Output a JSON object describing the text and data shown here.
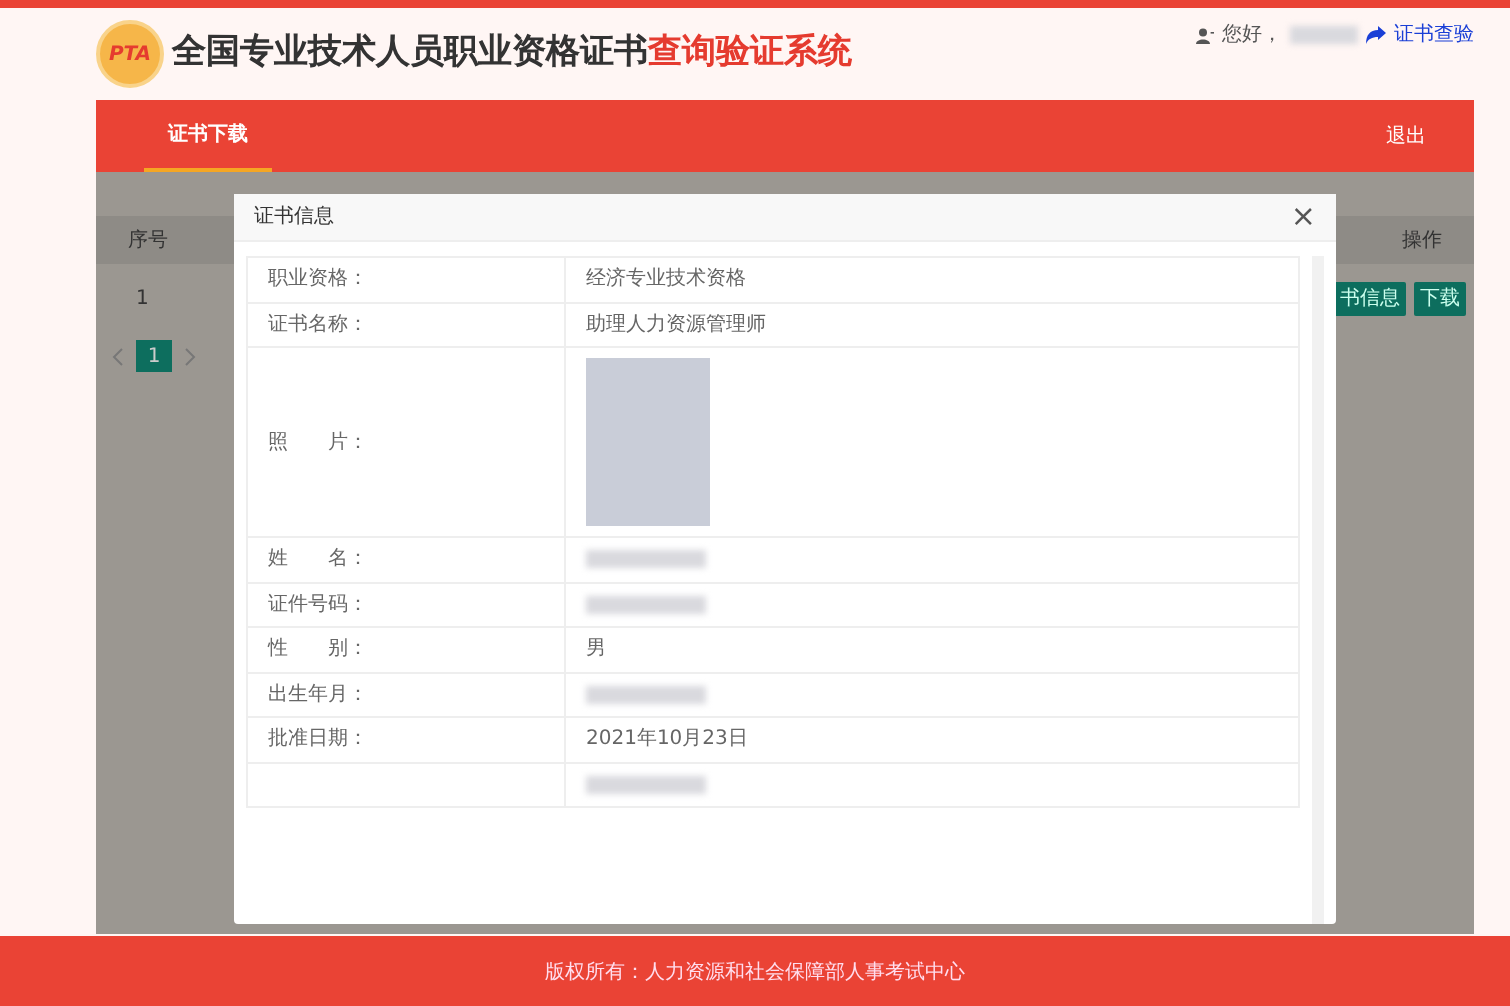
{
  "header": {
    "logo_text": "PTA",
    "title": "全国专业技术人员职业资格证书",
    "title_highlight": "查询验证系统",
    "greeting": "您好，",
    "user_link": "证书查验"
  },
  "nav": {
    "tabs": [
      {
        "label": "证书下载",
        "selected": true
      }
    ],
    "logout": "退出"
  },
  "background_table": {
    "columns": [
      "序号",
      "操作"
    ],
    "rows": [
      {
        "number": "1",
        "actions": [
          "书信息",
          "下载"
        ]
      }
    ],
    "pagination": [
      {
        "label": "1",
        "selected": true
      }
    ]
  },
  "modal": {
    "title": "证书信息",
    "close": "×",
    "rows": [
      {
        "kind": "text",
        "label": "职业资格：",
        "value": "经济专业技术资格"
      },
      {
        "kind": "text",
        "label": "证书名称：",
        "value": "助理人力资源管理师"
      },
      {
        "kind": "photo",
        "label": "照　　片："
      },
      {
        "kind": "redacted",
        "label": "姓　　名："
      },
      {
        "kind": "redacted",
        "label": "证件号码："
      },
      {
        "kind": "text",
        "label": "性　　别：",
        "value": "男"
      },
      {
        "kind": "redacted",
        "label": "出生年月："
      },
      {
        "kind": "text",
        "label": "批准日期：",
        "value": "2021年10月23日"
      },
      {
        "kind": "redacted"
      }
    ]
  },
  "footer": "版权所有：人力资源和社会保障部人事考试中心"
}
